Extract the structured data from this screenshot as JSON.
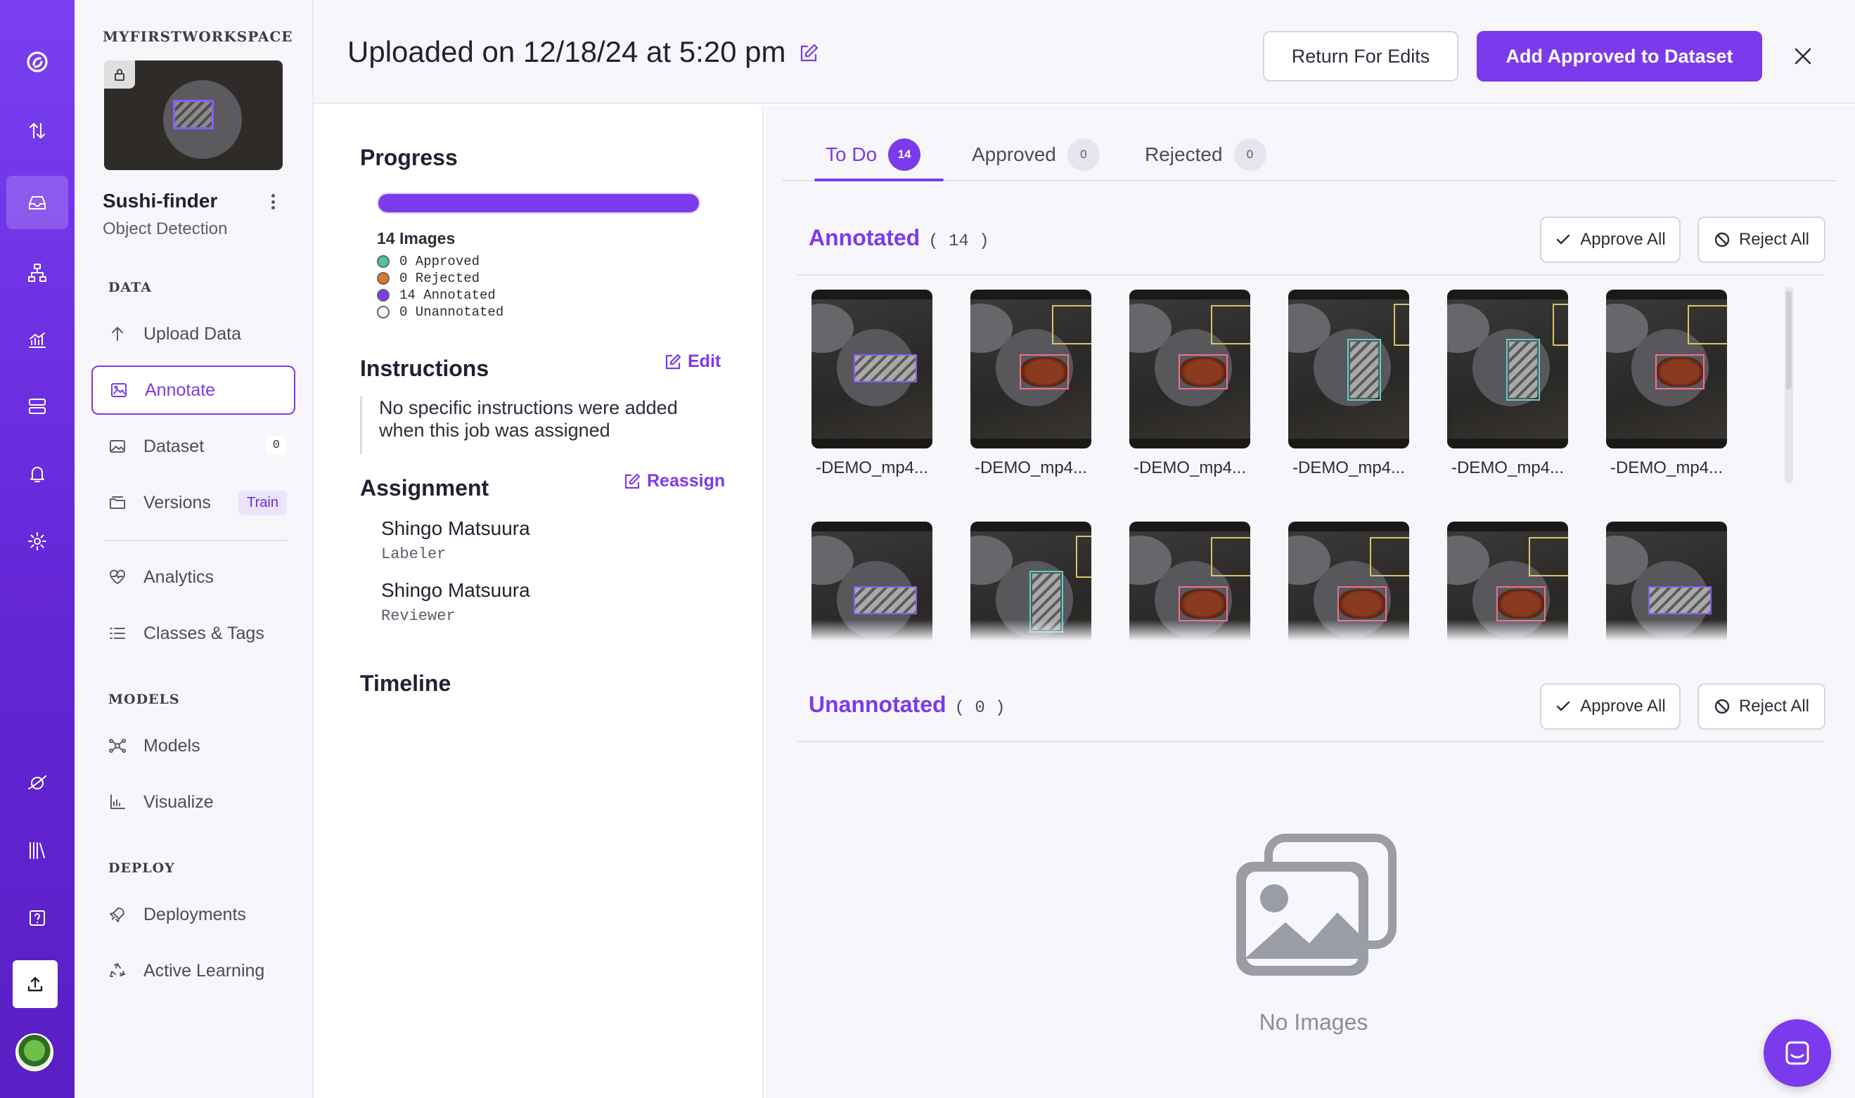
{
  "workspace": {
    "name": "MYFIRSTWORKSPACE"
  },
  "project": {
    "name": "Sushi-finder",
    "type": "Object Detection"
  },
  "rail": {
    "icons": [
      "logo-icon",
      "upload-sort-icon",
      "inbox-icon",
      "hierarchy-icon",
      "analytics-icon",
      "server-icon",
      "bell-icon",
      "settings-icon",
      "universe-icon",
      "library-icon",
      "help-icon",
      "upload-icon",
      "avatar"
    ]
  },
  "sidebar": {
    "sections": {
      "data": "DATA",
      "models": "MODELS",
      "deploy": "DEPLOY"
    },
    "items": [
      {
        "label": "Upload Data",
        "icon": "arrow-up-icon"
      },
      {
        "label": "Annotate",
        "icon": "annotate-icon",
        "active": true
      },
      {
        "label": "Dataset",
        "icon": "image-icon",
        "badge": "0"
      },
      {
        "label": "Versions",
        "icon": "versions-icon",
        "badge": "Train"
      },
      {
        "label": "Analytics",
        "icon": "heart-pulse-icon"
      },
      {
        "label": "Classes & Tags",
        "icon": "list-icon"
      },
      {
        "label": "Models",
        "icon": "nodes-icon"
      },
      {
        "label": "Visualize",
        "icon": "bar-chart-icon"
      },
      {
        "label": "Deployments",
        "icon": "rocket-icon"
      },
      {
        "label": "Active Learning",
        "icon": "recycle-icon"
      }
    ]
  },
  "header": {
    "title": "Uploaded on 12/18/24 at 5:20 pm",
    "return_label": "Return For Edits",
    "add_label": "Add Approved to Dataset"
  },
  "progress": {
    "heading": "Progress",
    "fraction": 1.0,
    "images_label": "14 Images",
    "legend": [
      {
        "label": "0 Approved",
        "color": "#4fc3a1"
      },
      {
        "label": "0 Rejected",
        "color": "#d9782a"
      },
      {
        "label": "14 Annotated",
        "color": "#7c3aed"
      },
      {
        "label": "0 Unannotated",
        "color": "#ffffff"
      }
    ]
  },
  "instructions": {
    "heading": "Instructions",
    "edit_label": "Edit",
    "text": "No specific instructions were added when this job was assigned"
  },
  "assignment": {
    "heading": "Assignment",
    "reassign_label": "Reassign",
    "people": [
      {
        "name": "Shingo Matsuura",
        "role": "Labeler"
      },
      {
        "name": "Shingo Matsuura",
        "role": "Reviewer"
      }
    ]
  },
  "timeline": {
    "heading": "Timeline"
  },
  "tabs": [
    {
      "label": "To Do",
      "count": "14",
      "active": true
    },
    {
      "label": "Approved",
      "count": "0"
    },
    {
      "label": "Rejected",
      "count": "0"
    }
  ],
  "annotated": {
    "title": "Annotated",
    "count": "( 14 )",
    "approve_label": "Approve All",
    "reject_label": "Reject All",
    "images": [
      {
        "label": "-DEMO_mp4...",
        "kind": "sushi"
      },
      {
        "label": "-DEMO_mp4...",
        "kind": "eel"
      },
      {
        "label": "-DEMO_mp4...",
        "kind": "eel"
      },
      {
        "label": "-DEMO_mp4...",
        "kind": "sushi-v"
      },
      {
        "label": "-DEMO_mp4...",
        "kind": "sushi-v"
      },
      {
        "label": "-DEMO_mp4...",
        "kind": "eel"
      },
      {
        "label": "",
        "kind": "sushi"
      },
      {
        "label": "",
        "kind": "sushi-v"
      },
      {
        "label": "",
        "kind": "eel"
      },
      {
        "label": "",
        "kind": "eel"
      },
      {
        "label": "",
        "kind": "eel"
      },
      {
        "label": "",
        "kind": "sushi"
      }
    ]
  },
  "unannotated": {
    "title": "Unannotated",
    "count": "( 0 )",
    "approve_label": "Approve All",
    "reject_label": "Reject All",
    "empty_text": "No Images"
  },
  "colors": {
    "accent": "#7c3aed",
    "rail_top": "#7a3ff2",
    "rail_bottom": "#5a1fc4"
  }
}
